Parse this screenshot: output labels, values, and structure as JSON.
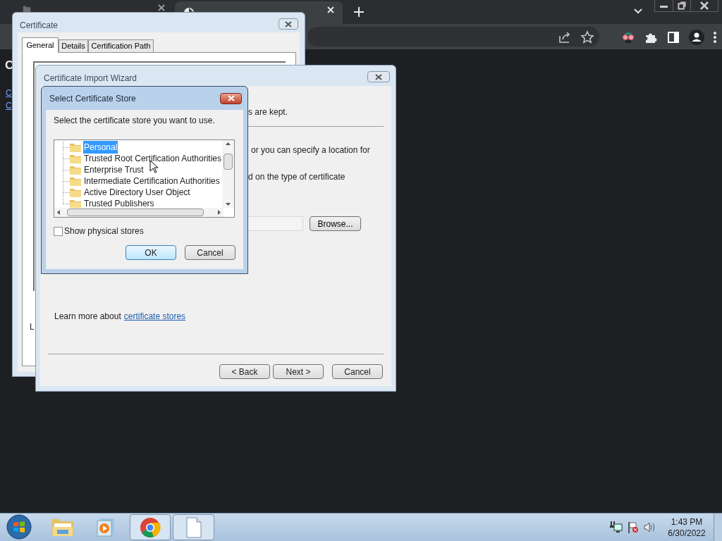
{
  "browser": {
    "tabs": [
      {
        "selected": false
      },
      {
        "selected": true
      }
    ]
  },
  "page": {
    "heading": "C",
    "links": [
      "C",
      "C"
    ]
  },
  "certificate_window": {
    "title": "Certificate",
    "tabs": [
      {
        "label": "General",
        "selected": true
      },
      {
        "label": "Details",
        "selected": false
      },
      {
        "label": "Certification Path",
        "selected": false
      }
    ],
    "text": "L"
  },
  "import_wizard": {
    "title": "Certificate Import Wizard",
    "texts": [
      "s are kept.",
      "or you can specify a location for",
      "d on the type of certificate"
    ],
    "browse_button": "Browse...",
    "learn_more": "Learn more about",
    "learn_more_link": "certificate stores",
    "buttons": [
      "< Back",
      "Next >",
      "Cancel"
    ]
  },
  "select_store_dialog": {
    "title": "Select Certificate Store",
    "prompt": "Select the certificate store you want to use.",
    "stores": [
      {
        "label": "Personal",
        "selected": true
      },
      {
        "label": "Trusted Root Certification Authorities",
        "selected": false
      },
      {
        "label": "Enterprise Trust",
        "selected": false
      },
      {
        "label": "Intermediate Certification Authorities",
        "selected": false
      },
      {
        "label": "Active Directory User Object",
        "selected": false
      },
      {
        "label": "Trusted Publishers",
        "selected": false
      }
    ],
    "show_physical_stores": {
      "label": "Show physical stores",
      "checked": false
    },
    "buttons": [
      "OK",
      "Cancel"
    ]
  },
  "taskbar": {
    "time": "1:43 PM",
    "date": "6/30/2022"
  }
}
